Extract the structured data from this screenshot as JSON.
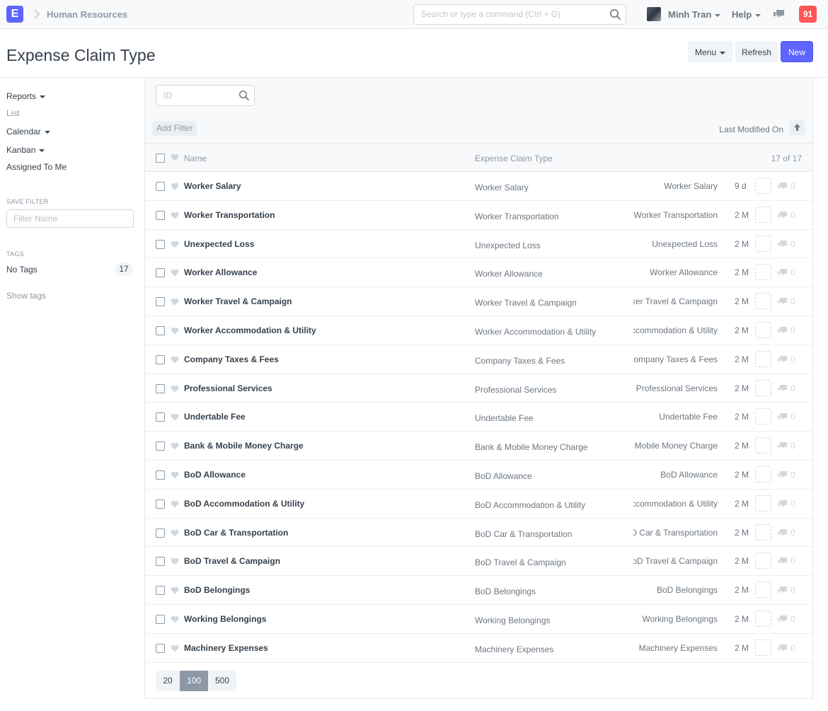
{
  "navbar": {
    "logo_letter": "E",
    "breadcrumb": "Human Resources",
    "search_placeholder": "Search or type a command (Ctrl + G)",
    "user_name": "Minh Tran",
    "help_label": "Help",
    "notification_count": "91"
  },
  "page": {
    "title": "Expense Claim Type",
    "menu_label": "Menu",
    "refresh_label": "Refresh",
    "new_label": "New"
  },
  "sidebar": {
    "reports": "Reports",
    "list": "List",
    "calendar": "Calendar",
    "kanban": "Kanban",
    "assigned_to_me": "Assigned To Me",
    "save_filter_label": "SAVE FILTER",
    "filter_name_placeholder": "Filter Name",
    "tags_label": "TAGS",
    "no_tags": "No Tags",
    "no_tags_count": "17",
    "show_tags": "Show tags"
  },
  "list": {
    "id_placeholder": "ID",
    "add_filter": "Add Filter",
    "sort_label": "Last Modified On",
    "col_name": "Name",
    "col_type": "Expense Claim Type",
    "count": "17 of 17",
    "rows": [
      {
        "name": "Worker Salary",
        "type": "Worker Salary",
        "title": "Worker Salary",
        "time": "9 d",
        "comments": "0"
      },
      {
        "name": "Worker Transportation",
        "type": "Worker Transportation",
        "title": "Worker Transportation",
        "time": "2 M",
        "comments": "0"
      },
      {
        "name": "Unexpected Loss",
        "type": "Unexpected Loss",
        "title": "Unexpected Loss",
        "time": "2 M",
        "comments": "0"
      },
      {
        "name": "Worker Allowance",
        "type": "Worker Allowance",
        "title": "Worker Allowance",
        "time": "2 M",
        "comments": "0"
      },
      {
        "name": "Worker Travel & Campaign",
        "type": "Worker Travel & Campaign",
        "title": "Worker Travel & Campaign",
        "time": "2 M",
        "comments": "0"
      },
      {
        "name": "Worker Accommodation & Utility",
        "type": "Worker Accommodation & Utility",
        "title": "Worker Accommodation & Utility",
        "time": "2 M",
        "comments": "0"
      },
      {
        "name": "Company Taxes & Fees",
        "type": "Company Taxes & Fees",
        "title": "Company Taxes & Fees",
        "time": "2 M",
        "comments": "0"
      },
      {
        "name": "Professional Services",
        "type": "Professional Services",
        "title": "Professional Services",
        "time": "2 M",
        "comments": "0"
      },
      {
        "name": "Undertable Fee",
        "type": "Undertable Fee",
        "title": "Undertable Fee",
        "time": "2 M",
        "comments": "0"
      },
      {
        "name": "Bank & Mobile Money Charge",
        "type": "Bank & Mobile Money Charge",
        "title": "Bank & Mobile Money Charge",
        "time": "2 M",
        "comments": "0"
      },
      {
        "name": "BoD Allowance",
        "type": "BoD Allowance",
        "title": "BoD Allowance",
        "time": "2 M",
        "comments": "0"
      },
      {
        "name": "BoD Accommodation & Utility",
        "type": "BoD Accommodation & Utility",
        "title": "BoD Accommodation & Utility",
        "time": "2 M",
        "comments": "0"
      },
      {
        "name": "BoD Car & Transportation",
        "type": "BoD Car & Transportation",
        "title": "BoD Car & Transportation",
        "time": "2 M",
        "comments": "0"
      },
      {
        "name": "BoD Travel & Campaign",
        "type": "BoD Travel & Campaign",
        "title": "BoD Travel & Campaign",
        "time": "2 M",
        "comments": "0"
      },
      {
        "name": "BoD Belongings",
        "type": "BoD Belongings",
        "title": "BoD Belongings",
        "time": "2 M",
        "comments": "0"
      },
      {
        "name": "Working Belongings",
        "type": "Working Belongings",
        "title": "Working Belongings",
        "time": "2 M",
        "comments": "0"
      },
      {
        "name": "Machinery Expenses",
        "type": "Machinery Expenses",
        "title": "Machinery Expenses",
        "time": "2 M",
        "comments": "0"
      }
    ],
    "paging": [
      "20",
      "100",
      "500"
    ],
    "paging_selected": "100"
  },
  "icons": {
    "search": "search-icon",
    "heart": "heart-icon",
    "comment": "comment-icon",
    "sort": "sort-ascending-icon"
  },
  "colors": {
    "primary": "#5e64ff",
    "notification": "#ff5858",
    "muted_text": "#8d99a6"
  }
}
